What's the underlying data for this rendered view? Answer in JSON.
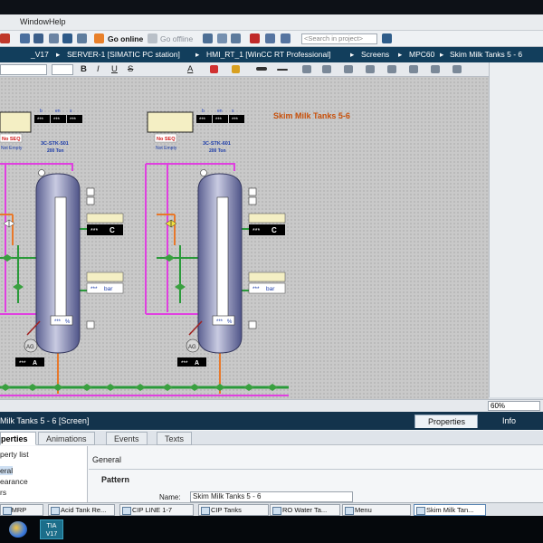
{
  "menu": {
    "window": "Window",
    "help": "Help"
  },
  "toolbar": {
    "go_online": "Go online",
    "go_offline": "Go offline",
    "search_placeholder": "<Search in project>"
  },
  "breadcrumb": [
    "_V17",
    "SERVER-1 [SIMATIC PC station]",
    "HMI_RT_1 [WinCC RT Professional]",
    "Screens",
    "MPC60",
    "Skim Milk Tanks 5 - 6"
  ],
  "breadcrumb_sep": "▸",
  "format": {
    "bold": "B",
    "italic": "I",
    "underline": "U",
    "strike": "S",
    "text_color": "A"
  },
  "screen": {
    "title": "Skim Milk Tanks 5-6",
    "tanks": [
      {
        "name": "3C-STK-501",
        "capacity": "200 Ton",
        "status_top": "No SEQ",
        "status_bottom": "Not Empty",
        "small_labels": [
          "b",
          "en",
          "s"
        ],
        "triple": [
          "***",
          "***",
          "***"
        ],
        "temp_value": "***",
        "temp_unit": "C",
        "pressure_value": "***",
        "pressure_unit": "bar",
        "level_value": "***",
        "level_unit": "%",
        "ag_label": "AG",
        "agitator_value": "***",
        "agitator_unit": "A"
      },
      {
        "name": "3C-STK-601",
        "capacity": "200 Ton",
        "status_top": "No SEQ",
        "status_bottom": "Not Empty",
        "small_labels": [
          "b",
          "en",
          "s"
        ],
        "triple": [
          "***",
          "***",
          "***"
        ],
        "temp_value": "***",
        "temp_unit": "C",
        "pressure_value": "***",
        "pressure_unit": "bar",
        "level_value": "***",
        "level_unit": "%",
        "ag_label": "AG",
        "agitator_value": "***",
        "agitator_unit": "A"
      }
    ]
  },
  "zoom": "60%",
  "inspector": {
    "title": "Milk Tanks 5 - 6 [Screen]",
    "tabs": {
      "properties": "Properties",
      "info": "Info"
    },
    "subtabs": [
      "perties",
      "Animations",
      "Events",
      "Texts"
    ],
    "prop_list": [
      "perty list",
      "eral",
      "earance",
      "rs"
    ],
    "general": "General",
    "pattern": "Pattern",
    "name_label": "Name:",
    "name_value": "Skim Milk Tanks 5 - 6"
  },
  "taskbar": [
    "C_MRP",
    "Acid Tank Re...",
    "CIP LINE 1-7",
    "CIP Tanks",
    "RO Water Ta...",
    "Menu",
    "Skim Milk Tan..."
  ],
  "tia": {
    "line1": "TIA",
    "line2": "V17"
  },
  "colors": {
    "pink_line": "#e040e0",
    "orange_line": "#e8782a",
    "green_line": "#2a9a3a",
    "tank_body": "#7a7fae",
    "display_bg": "#000000",
    "display_fg": "#ffffff",
    "status_red": "#d01818",
    "tag_blue": "#1a3aa8",
    "title_orange": "#c8500a",
    "header_navy": "#123e5c"
  }
}
